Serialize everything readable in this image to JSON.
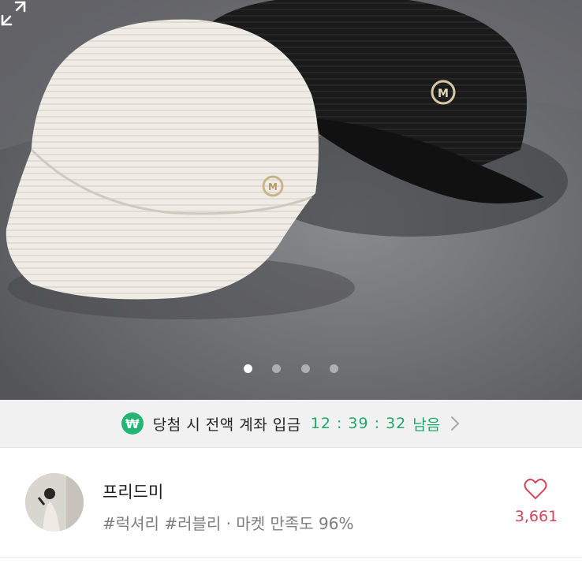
{
  "gallery": {
    "image_alt": "",
    "page_count": 4,
    "current_index": 0,
    "expand_icon": "expand-icon"
  },
  "auction_banner": {
    "icon": "won-coin-icon",
    "icon_glyph": "₩",
    "text": "당첨 시 전액 계좌 입금",
    "timer": "12 : 39 : 32",
    "timer_suffix": "남음",
    "arrow_icon": "chevron-right-icon",
    "accent_color": "#1fa86a"
  },
  "seller": {
    "name": "프리드미",
    "tags": "#럭셔리 #러블리 · 마켓 만족도 96%",
    "likes": "3,661",
    "like_icon": "heart-outline-icon",
    "like_color": "#d6445e"
  }
}
